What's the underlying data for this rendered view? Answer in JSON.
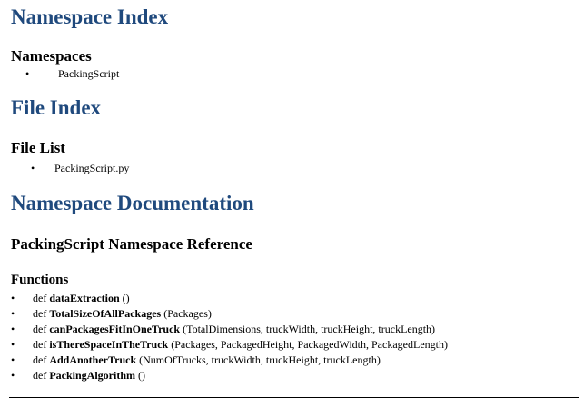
{
  "colors": {
    "heading": "#1f497d",
    "text": "#000000",
    "background": "#ffffff"
  },
  "namespace_index": {
    "title": "Namespace Index",
    "subtitle": "Namespaces",
    "items": [
      "PackingScript"
    ]
  },
  "file_index": {
    "title": "File Index",
    "subtitle": "File List",
    "items": [
      "PackingScript.py"
    ]
  },
  "namespace_documentation": {
    "title": "Namespace Documentation",
    "reference_title": "PackingScript Namespace Reference",
    "functions_heading": "Functions",
    "functions": [
      {
        "keyword": "def",
        "name": "dataExtraction",
        "params": "()"
      },
      {
        "keyword": "def",
        "name": "TotalSizeOfAllPackages",
        "params": "(Packages)"
      },
      {
        "keyword": "def",
        "name": "canPackagesFitInOneTruck",
        "params": "(TotalDimensions, truckWidth, truckHeight, truckLength)"
      },
      {
        "keyword": "def",
        "name": "isThereSpaceInTheTruck",
        "params": "(Packages, PackagedHeight, PackagedWidth, PackagedLength)"
      },
      {
        "keyword": "def",
        "name": "AddAnotherTruck",
        "params": "(NumOfTrucks, truckWidth, truckHeight, truckLength)"
      },
      {
        "keyword": "def",
        "name": "PackingAlgorithm",
        "params": "()"
      }
    ]
  }
}
